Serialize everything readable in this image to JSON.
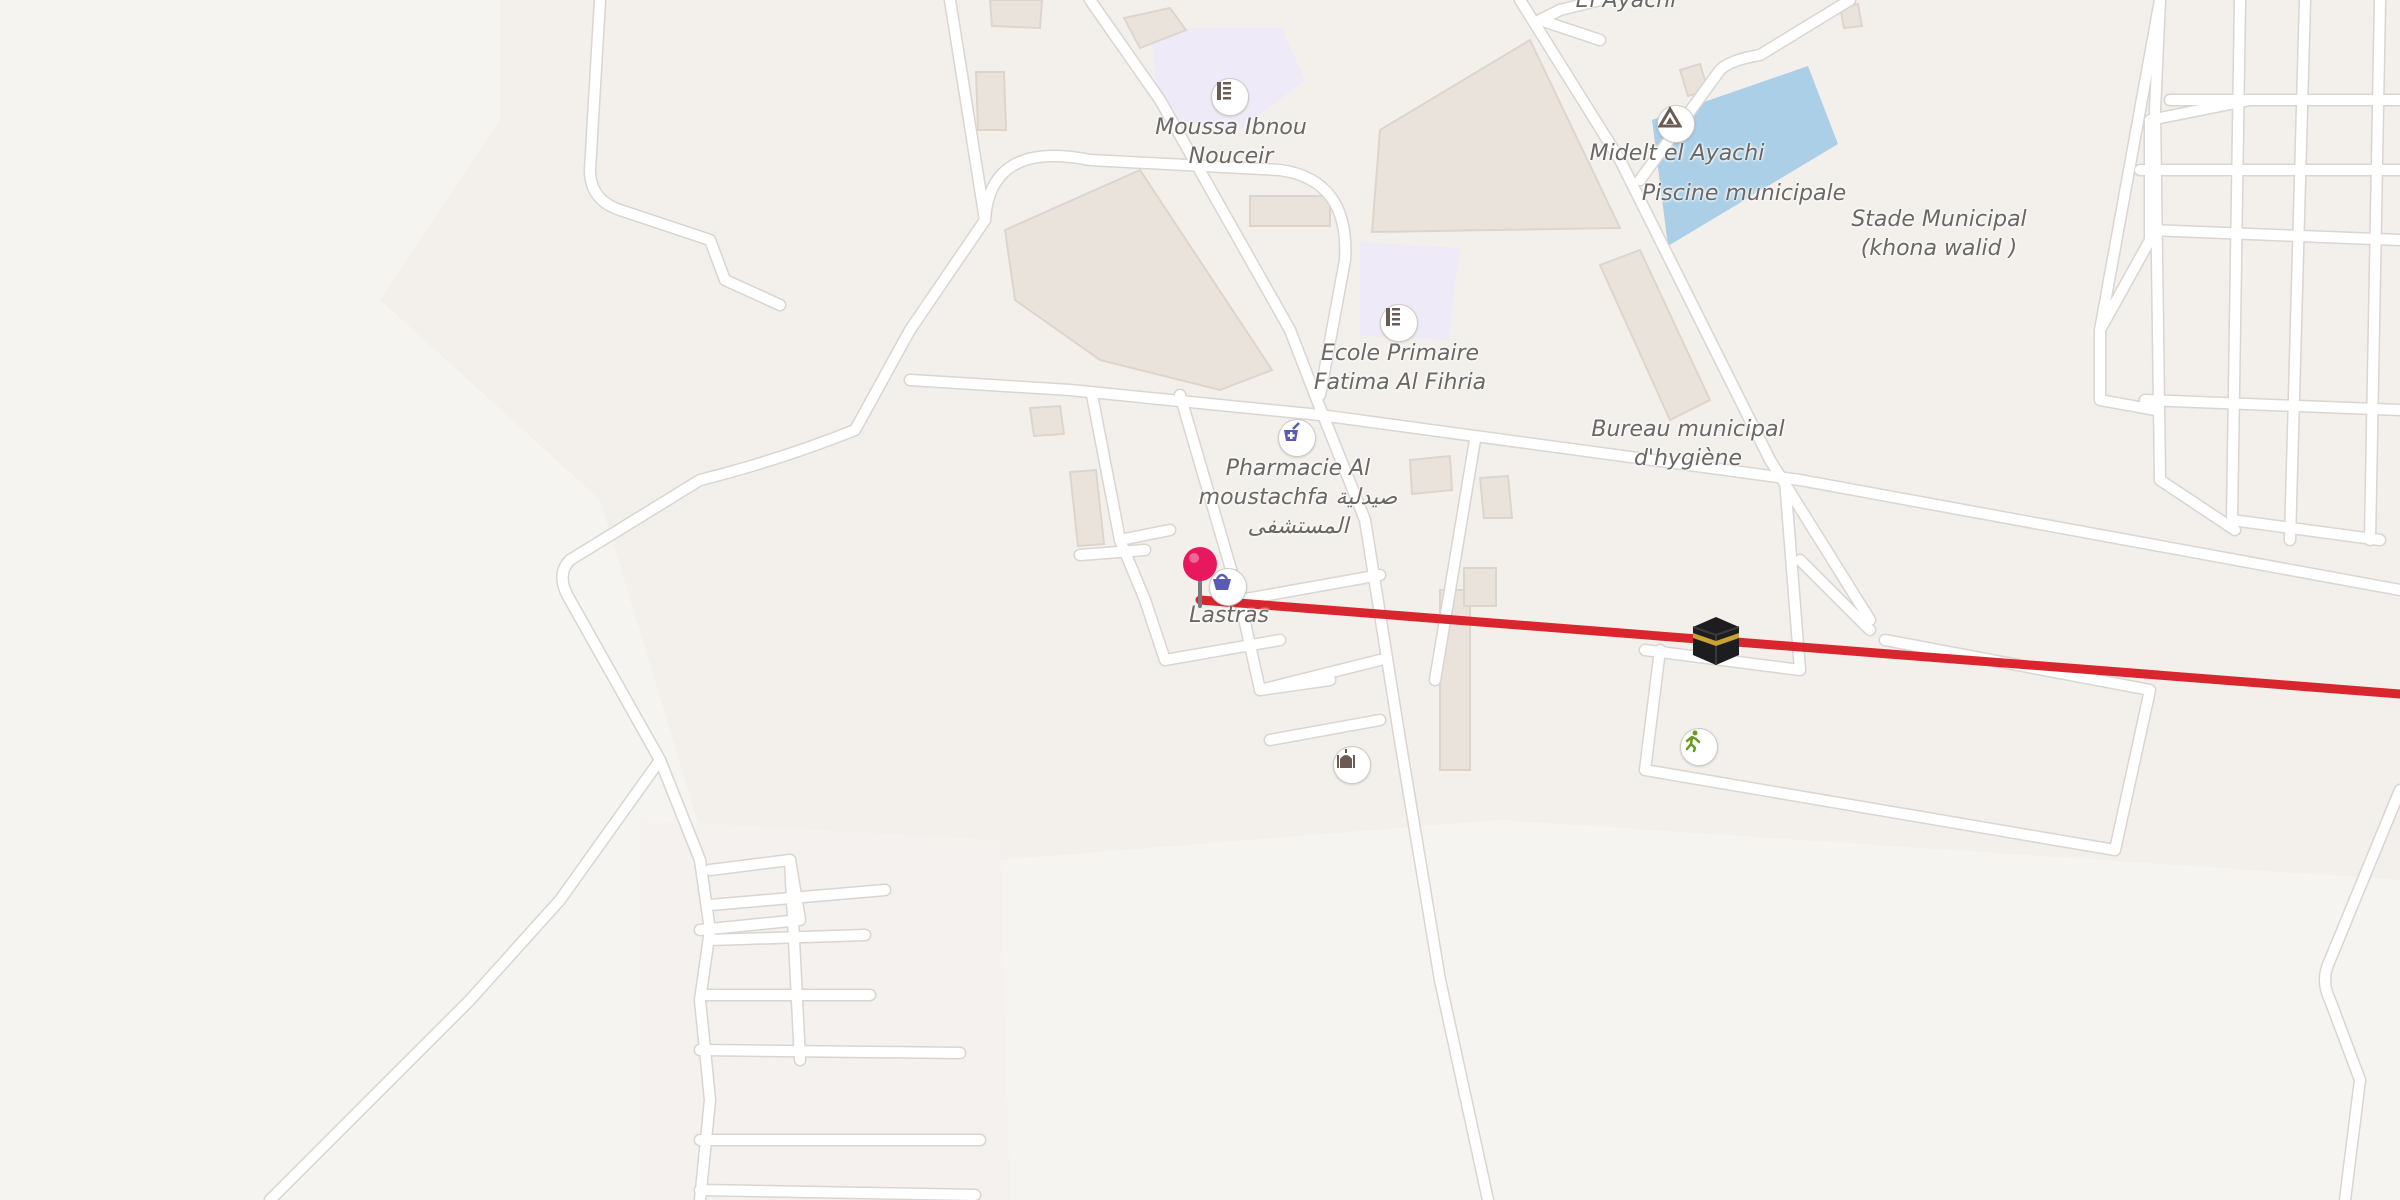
{
  "map": {
    "labels": {
      "moussa": "Moussa Ibnou\nNouceir",
      "el_ayachi_top": "El Ayachi",
      "midelt": "Midelt el Ayachi",
      "piscine": "Piscine municipale",
      "stade": "Stade Municipal\n(khona walid )",
      "ecole": "Ecole Primaire\nFatima Al Fihria",
      "bureau": "Bureau municipal\nd'hygiène",
      "pharmacie": "Pharmacie Al\nmoustachfa صيدلية\nالمستشفى",
      "lastras": "Lastras"
    },
    "icons": {
      "school_1": "school-icon",
      "school_2": "school-icon",
      "monument": "monument-icon",
      "pharmacy": "pharmacy-icon",
      "shop": "shopping-basket-icon",
      "mosque": "mosque-icon",
      "sport": "running-person-icon",
      "kaaba": "kaaba-icon",
      "pin": "location-pin-icon"
    },
    "colors": {
      "background": "#f6f4f1",
      "road": "#ffffff",
      "water": "#aacfe6",
      "school_area": "#eeeaf8",
      "route": "#d9262e",
      "pin": "#e8185e"
    }
  }
}
